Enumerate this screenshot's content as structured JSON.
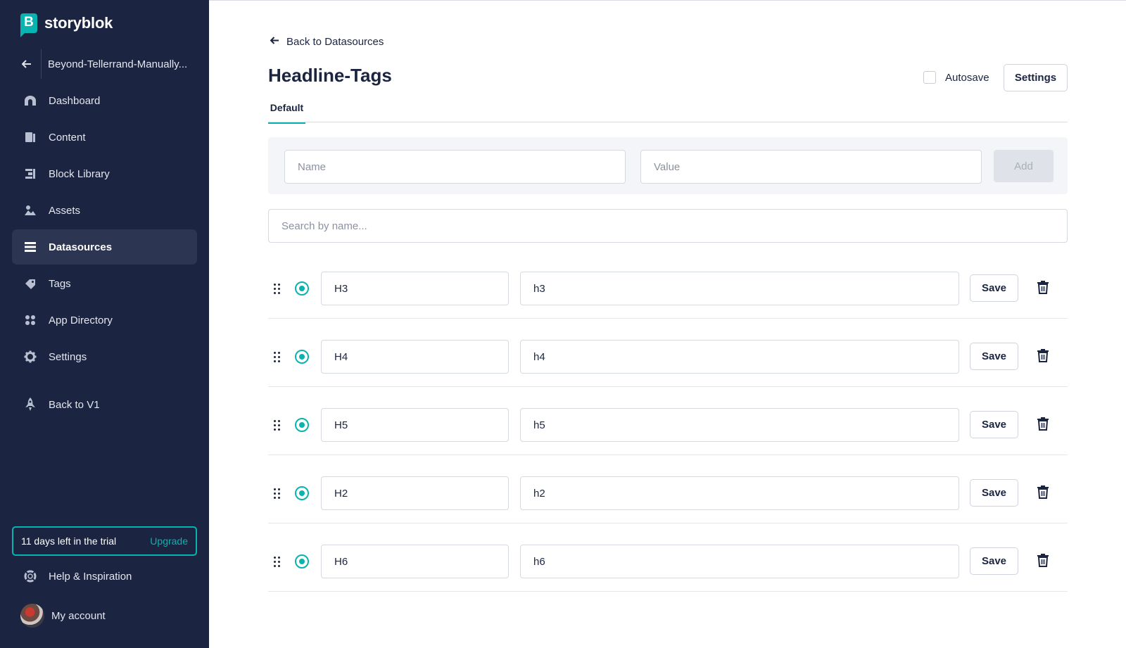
{
  "brand": {
    "name": "storyblok",
    "mark": "B",
    "accent": "#09b3af",
    "sidebar_bg": "#1b2440"
  },
  "space": {
    "name": "Beyond-Tellerrand-Manually..."
  },
  "nav": [
    {
      "label": "Dashboard",
      "icon": "dashboard-icon",
      "active": false
    },
    {
      "label": "Content",
      "icon": "content-icon",
      "active": false
    },
    {
      "label": "Block Library",
      "icon": "block-library-icon",
      "active": false
    },
    {
      "label": "Assets",
      "icon": "assets-icon",
      "active": false
    },
    {
      "label": "Datasources",
      "icon": "datasources-icon",
      "active": true
    },
    {
      "label": "Tags",
      "icon": "tags-icon",
      "active": false
    },
    {
      "label": "App Directory",
      "icon": "app-directory-icon",
      "active": false
    },
    {
      "label": "Settings",
      "icon": "settings-gear-icon",
      "active": false
    }
  ],
  "back_v1": {
    "label": "Back to V1",
    "icon": "rocket-icon"
  },
  "trial": {
    "text": "11 days left in the trial",
    "upgrade": "Upgrade"
  },
  "help": {
    "label": "Help & Inspiration",
    "icon": "lifebuoy-icon"
  },
  "account": {
    "label": "My account"
  },
  "header": {
    "back_label": "Back to Datasources",
    "title": "Headline-Tags",
    "autosave_label": "Autosave",
    "autosave_checked": false,
    "settings_label": "Settings"
  },
  "tabs": [
    {
      "label": "Default",
      "active": true
    }
  ],
  "add_form": {
    "name_placeholder": "Name",
    "value_placeholder": "Value",
    "add_label": "Add"
  },
  "search": {
    "placeholder": "Search by name..."
  },
  "entries": [
    {
      "name": "H3",
      "value": "h3",
      "save_label": "Save"
    },
    {
      "name": "H4",
      "value": "h4",
      "save_label": "Save"
    },
    {
      "name": "H5",
      "value": "h5",
      "save_label": "Save"
    },
    {
      "name": "H2",
      "value": "h2",
      "save_label": "Save"
    },
    {
      "name": "H6",
      "value": "h6",
      "save_label": "Save"
    }
  ]
}
